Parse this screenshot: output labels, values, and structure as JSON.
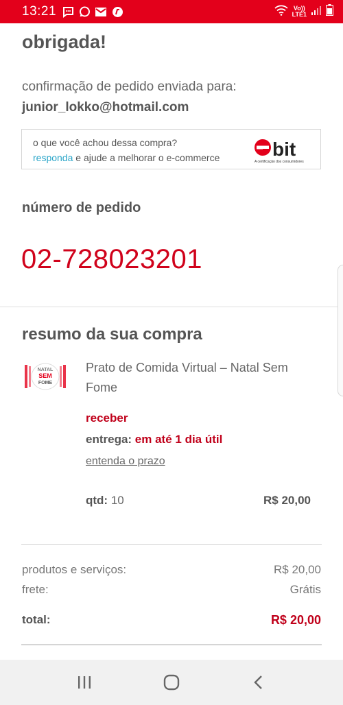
{
  "status_bar": {
    "time": "13:21",
    "network_line1": "Vo))",
    "network_line2": "LTE1",
    "background": "#e3001b",
    "left_icons": [
      "message-icon",
      "whatsapp-icon",
      "gmail-icon",
      "app-icon"
    ],
    "right_icons": [
      "wifi-icon",
      "signal-icon",
      "battery-icon"
    ]
  },
  "confirmation": {
    "heading": "obrigada!",
    "sent_to_label": "confirmação de pedido enviada para:",
    "email": "junior_lokko@hotmail.com"
  },
  "ebit": {
    "question": "o que você achou dessa compra?",
    "link_text": "responda",
    "cta_rest": " e ajude a melhorar o e-commerce",
    "logo_text": "bit",
    "logo_subtext": "A certificação dos consumidores",
    "link_color": "#2aa5c8"
  },
  "order": {
    "label": "número de pedido",
    "number": "02-728023201",
    "number_color": "#d0021b"
  },
  "summary": {
    "title": "resumo da sua compra",
    "product": {
      "thumbnail_text": [
        "NATAL",
        "SEM",
        "FOME"
      ],
      "name": "Prato de Comida Virtual – Natal Sem Fome",
      "receive_label": "receber",
      "delivery_label": "entrega:",
      "delivery_value": " em até 1 dia útil",
      "prazo_link": "entenda o prazo",
      "qty_label": "qtd:",
      "qty_value": " 10",
      "price": "R$ 20,00"
    }
  },
  "totals": {
    "products_label": "produtos e serviços:",
    "products_value": "R$ 20,00",
    "shipping_label": "frete:",
    "shipping_value": "Grátis",
    "total_label": "total:",
    "total_value": "R$ 20,00",
    "accent_color": "#c0001a"
  },
  "nav_bar": {
    "buttons": [
      "recent-apps-icon",
      "home-icon",
      "back-icon"
    ]
  }
}
